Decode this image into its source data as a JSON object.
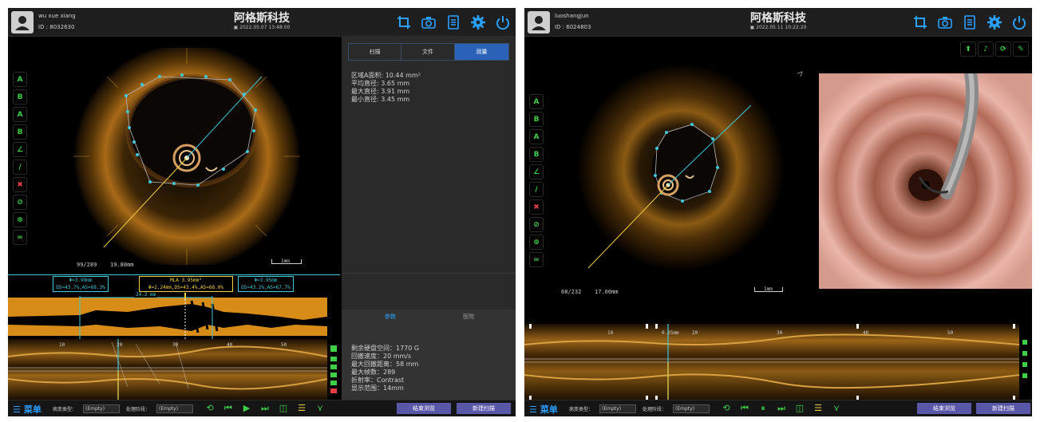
{
  "brand": "阿格斯科技",
  "colors": {
    "accent_green": "#3fd048",
    "accent_blue": "#2a62b8",
    "cyan": "#3fc8d8",
    "gold": "#e8a020",
    "button": "#5a56a8"
  },
  "header_icons": [
    "crop-icon",
    "camera-icon",
    "document-icon",
    "gear-icon",
    "power-icon"
  ],
  "tool_icons": [
    "tool-a-circle-icon",
    "tool-b-circle-icon",
    "tool-a-point-icon",
    "tool-b-point-icon",
    "angle-icon",
    "line-icon",
    "delete-icon",
    "hide-icon",
    "zoom-icon",
    "link-icon"
  ],
  "tool_glyphs": [
    "A",
    "B",
    "A",
    "B",
    "∠",
    "∕",
    "✖",
    "⊘",
    "⊕",
    "∞"
  ],
  "w1": {
    "user": "wu xue xiang",
    "id": "ID : 8032630",
    "datetime": "2022.05.07 13:48:00",
    "frame": "99/289",
    "depth": "19.80mm",
    "scale": "1mm",
    "tabs": [
      "扫描",
      "文件",
      "测量"
    ],
    "measure": [
      "区域A面积: 10.44 mm²",
      "平均直径: 3.65 mm",
      "最大直径: 3.91 mm",
      "最小直径: 3.45 mm"
    ],
    "subtabs": [
      "参数",
      "医院"
    ],
    "params": [
      "剩余硬盘空间：1770 G",
      "回撤速度：20 mm/s",
      "最大回撤距离：58 mm",
      "最大帧数：289",
      "折射率：Contrast",
      "显示范围：14mm"
    ],
    "callouts": [
      [
        "Φ=3.99mm",
        "DS=43.7%,AS=68.3%"
      ],
      [
        "MLA 3.95mm²",
        "Φ=2.24mm,DS=43.4%,AS=68.0%"
      ],
      [
        "Φ=3.95mm",
        "DS=43.2%,AS=67.7%"
      ]
    ],
    "length": "24.2 mm",
    "ticks": [
      "10",
      "20",
      "30",
      "40",
      "50"
    ]
  },
  "w2": {
    "user": "luoshangjun",
    "id": "ID : 6024803",
    "datetime": "2022.05.11 10:22:20",
    "frame": "68/232",
    "depth": "17.00mm",
    "scale": "1mm",
    "ticks": [
      "10",
      "0.25mm",
      "20",
      "30",
      "40",
      "50"
    ]
  },
  "footer": {
    "menu": "菜单",
    "lesion_label": "病变类型：",
    "lesion_value": "(Empty)",
    "stage_label": "处理阶段：",
    "stage_value": "(Empty)",
    "end_button": "结束浏览",
    "new_button": "新建扫描"
  }
}
